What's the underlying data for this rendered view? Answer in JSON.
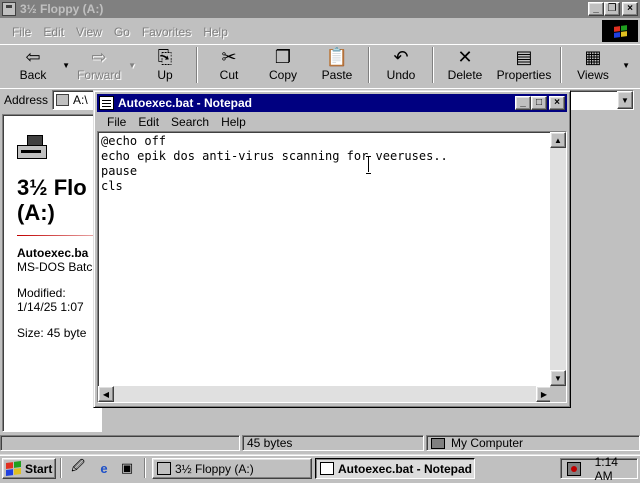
{
  "explorer": {
    "title": "3½ Floppy (A:)",
    "menu": [
      "File",
      "Edit",
      "View",
      "Go",
      "Favorites",
      "Help"
    ],
    "toolbar": {
      "back": "Back",
      "forward": "Forward",
      "up": "Up",
      "cut": "Cut",
      "copy": "Copy",
      "paste": "Paste",
      "undo": "Undo",
      "delete": "Delete",
      "properties": "Properties",
      "views": "Views"
    },
    "address_label": "Address",
    "address_value": "A:\\",
    "left_pane": {
      "title_line1": "3½ Flo",
      "title_line2": "(A:)",
      "selected_name": "Autoexec.ba",
      "selected_type": "MS-DOS Batc",
      "modified_label": "Modified:",
      "modified_value": "1/14/25 1:07",
      "size_text": "Size: 45 byte"
    },
    "status": {
      "size": "45 bytes",
      "zone": "My Computer"
    }
  },
  "notepad": {
    "title": "Autoexec.bat - Notepad",
    "menu": [
      "File",
      "Edit",
      "Search",
      "Help"
    ],
    "content": "@echo off\necho epik dos anti-virus scanning for veeruses..\npause\ncls"
  },
  "taskbar": {
    "start_label": "Start",
    "tasks": [
      "3½ Floppy (A:)",
      "Autoexec.bat - Notepad"
    ],
    "active_task": "Autoexec.bat - Notepad",
    "clock": "1:14 AM"
  },
  "colors": {
    "active_title": "#000080",
    "inactive_title": "#808080",
    "face": "#c0c0c0"
  },
  "icons": {
    "toolbar": [
      "back-arrow-icon",
      "forward-arrow-icon",
      "up-folder-icon",
      "scissors-icon",
      "copy-icon",
      "paste-icon",
      "undo-icon",
      "delete-x-icon",
      "properties-icon",
      "views-icon"
    ],
    "quick_launch": [
      "active-desktop-icon",
      "internet-explorer-icon",
      "show-desktop-icon"
    ]
  }
}
